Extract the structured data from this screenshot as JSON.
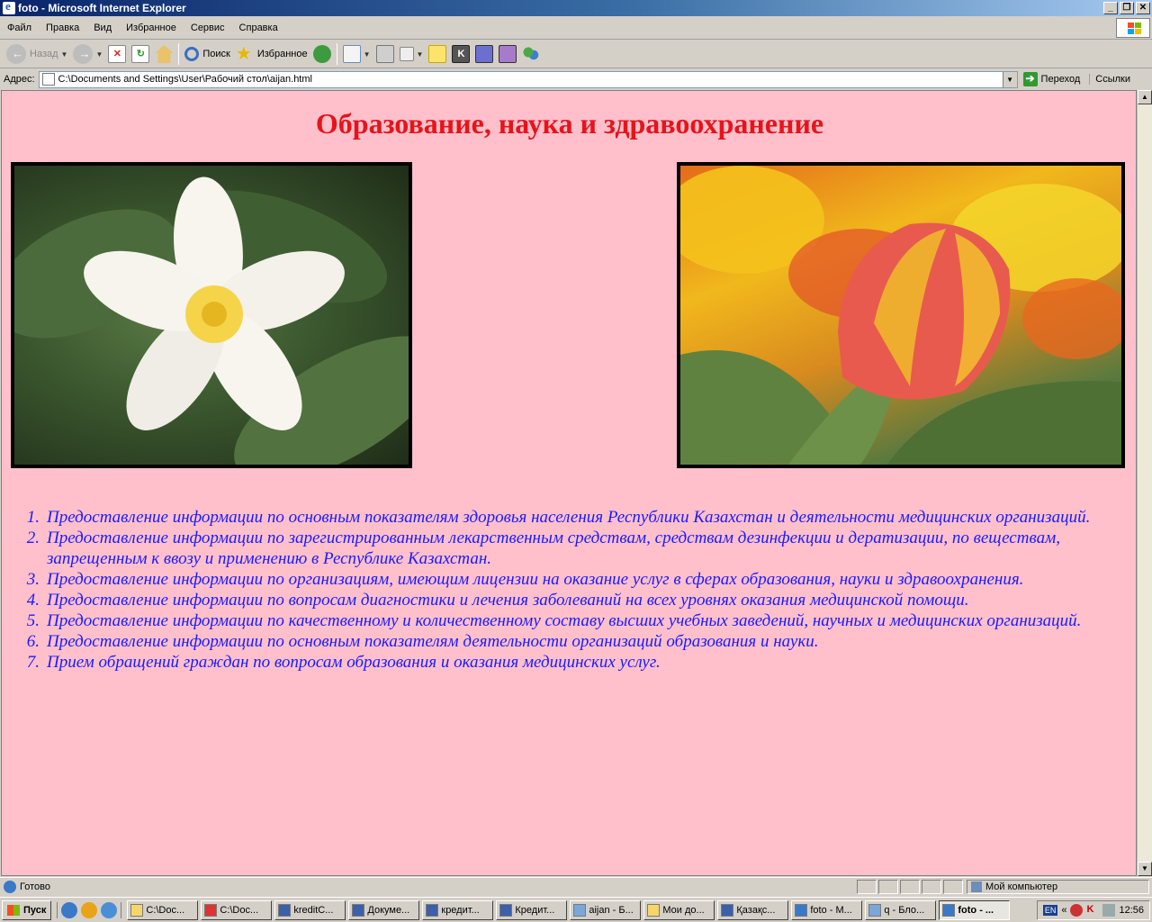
{
  "window": {
    "title": "foto - Microsoft Internet Explorer"
  },
  "menu": [
    "Файл",
    "Правка",
    "Вид",
    "Избранное",
    "Сервис",
    "Справка"
  ],
  "toolbar": {
    "back": "Назад",
    "search": "Поиск",
    "favorites": "Избранное"
  },
  "address": {
    "label": "Адрес:",
    "value": "C:\\Documents and Settings\\User\\Рабочий стол\\aijan.html",
    "go": "Переход",
    "links": "Ссылки"
  },
  "page": {
    "title": "Образование, наука и здравоохранение",
    "items": [
      {
        "num": "1.",
        "text": "Предоставление информации по основным показателям здоровья населения Республики Казахстан и деятельности медицинских организаций."
      },
      {
        "num": "2.",
        "text": "Предоставление информации по зарегистрированным лекарственным средствам, средствам дезинфекции и дератизации, по веществам, запрещенным к ввозу и применению в Республике Казахстан."
      },
      {
        "num": "3.",
        "text": "Предоставление информации по организациям, имеющим лицензии на оказание услуг в сферах образования, науки и здравоохранения."
      },
      {
        "num": "4.",
        "text": "Предоставление информации по вопросам диагностики и лечения заболеваний на всех уровнях оказания медицинской помощи."
      },
      {
        "num": "5.",
        "text": "Предоставление информации по качественному и количественному составу высших учебных заведений, научных и медицинских организаций."
      },
      {
        "num": "6.",
        "text": "Предоставление информации по основным показателям деятельности организаций образования и науки."
      },
      {
        "num": "7.",
        "text": "Прием обращений граждан по вопросам образования и оказания медицинских услуг."
      }
    ],
    "colors": {
      "background": "#ffc0cb",
      "title": "#e8131a",
      "list": "#1a1aff"
    }
  },
  "status": {
    "text": "Готово",
    "zone": "Мой компьютер"
  },
  "taskbar": {
    "start": "Пуск",
    "tasks": [
      "C:\\Doc...",
      "C:\\Doc...",
      "kreditC...",
      "Докуме...",
      "кредит...",
      "Кредит...",
      "aijan - Б...",
      "Мои до...",
      "Қазақс...",
      "foto - M...",
      "q - Бло...",
      "foto - ..."
    ],
    "active_task": 11,
    "lang": "EN",
    "clock": "12:56"
  }
}
